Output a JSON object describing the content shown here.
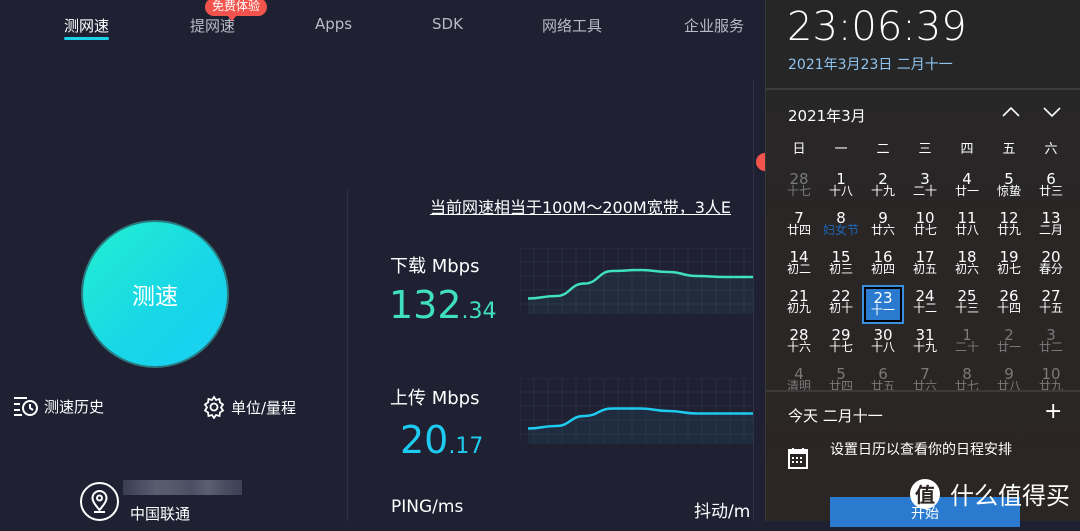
{
  "nav": {
    "items": [
      {
        "label": "测网速",
        "active": true
      },
      {
        "label": "提网速",
        "active": false
      },
      {
        "label": "Apps",
        "active": false
      },
      {
        "label": "SDK",
        "active": false
      },
      {
        "label": "网络工具",
        "active": false
      },
      {
        "label": "企业服务",
        "active": false
      }
    ],
    "badge": "免费体验"
  },
  "left": {
    "speed_button": "测速",
    "history": "测速历史",
    "units": "单位/量程",
    "isp": "中国联通"
  },
  "results": {
    "summary": "当前网速相当于100M～200M宽带，3人E",
    "download": {
      "label": "下载 Mbps",
      "int": "132",
      "dec": ".34",
      "color": "#3fe0c0",
      "trend": [
        0.15,
        0.2,
        0.45,
        0.7,
        0.72,
        0.68,
        0.6,
        0.58,
        0.58
      ]
    },
    "upload": {
      "label": "上传 Mbps",
      "int": "20",
      "dec": ".17",
      "color": "#1ecbf0",
      "trend": [
        0.15,
        0.2,
        0.4,
        0.55,
        0.55,
        0.5,
        0.45,
        0.45,
        0.45
      ]
    },
    "ping_label": "PING/ms",
    "jitter_label": "抖动/m"
  },
  "calendar": {
    "time": "23:06:39",
    "full_date": "2021年3月23日 二月十一",
    "month": "2021年3月",
    "weekdays": [
      "日",
      "一",
      "二",
      "三",
      "四",
      "五",
      "六"
    ],
    "days": [
      {
        "d": "28",
        "l": "十七",
        "other": true
      },
      {
        "d": "1",
        "l": "十八"
      },
      {
        "d": "2",
        "l": "十九"
      },
      {
        "d": "3",
        "l": "二十"
      },
      {
        "d": "4",
        "l": "廿一"
      },
      {
        "d": "5",
        "l": "惊蛰"
      },
      {
        "d": "6",
        "l": "廿三"
      },
      {
        "d": "7",
        "l": "廿四"
      },
      {
        "d": "8",
        "l": "妇女节",
        "fest": true
      },
      {
        "d": "9",
        "l": "廿六"
      },
      {
        "d": "10",
        "l": "廿七"
      },
      {
        "d": "11",
        "l": "廿八"
      },
      {
        "d": "12",
        "l": "廿九"
      },
      {
        "d": "13",
        "l": "二月"
      },
      {
        "d": "14",
        "l": "初二"
      },
      {
        "d": "15",
        "l": "初三"
      },
      {
        "d": "16",
        "l": "初四"
      },
      {
        "d": "17",
        "l": "初五"
      },
      {
        "d": "18",
        "l": "初六"
      },
      {
        "d": "19",
        "l": "初七"
      },
      {
        "d": "20",
        "l": "春分"
      },
      {
        "d": "21",
        "l": "初九"
      },
      {
        "d": "22",
        "l": "初十"
      },
      {
        "d": "23",
        "l": "十一",
        "today": true
      },
      {
        "d": "24",
        "l": "十二"
      },
      {
        "d": "25",
        "l": "十三"
      },
      {
        "d": "26",
        "l": "十四"
      },
      {
        "d": "27",
        "l": "十五"
      },
      {
        "d": "28",
        "l": "十六"
      },
      {
        "d": "29",
        "l": "十七"
      },
      {
        "d": "30",
        "l": "十八"
      },
      {
        "d": "31",
        "l": "十九"
      },
      {
        "d": "1",
        "l": "二十",
        "other": true
      },
      {
        "d": "2",
        "l": "廿一",
        "other": true
      },
      {
        "d": "3",
        "l": "廿二",
        "other": true
      },
      {
        "d": "4",
        "l": "清明",
        "other": true
      },
      {
        "d": "5",
        "l": "廿四",
        "other": true
      },
      {
        "d": "6",
        "l": "廿五",
        "other": true
      },
      {
        "d": "7",
        "l": "廿六",
        "other": true
      },
      {
        "d": "8",
        "l": "廿七",
        "other": true
      },
      {
        "d": "9",
        "l": "廿八",
        "other": true
      },
      {
        "d": "10",
        "l": "廿九",
        "other": true
      }
    ],
    "today_label": "今天 二月十一",
    "events_message": "设置日历以查看你的日程安排",
    "start_button": "开始"
  },
  "watermark": {
    "icon_char": "值",
    "text": "什么值得买"
  }
}
